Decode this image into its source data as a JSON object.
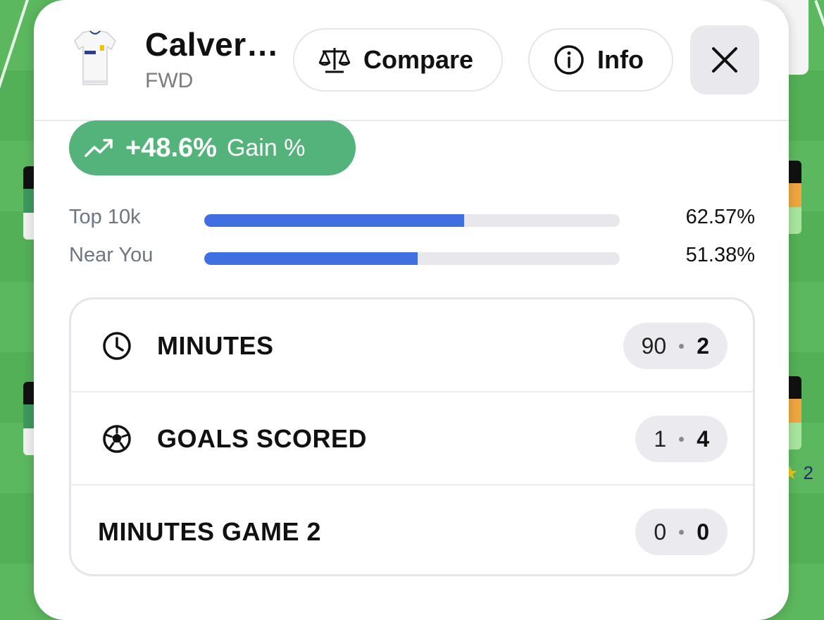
{
  "player": {
    "name": "Calver…",
    "position": "FWD",
    "jersey_icon": "leeds-jersey-icon"
  },
  "buttons": {
    "compare": "Compare",
    "info": "Info",
    "close_icon": "close-icon"
  },
  "gain": {
    "value": "+48.6%",
    "label": "Gain %",
    "color": "#53b37b",
    "icon": "trending-up-icon"
  },
  "ownership": [
    {
      "label": "Top 10k",
      "percent": 62.57,
      "display": "62.57%"
    },
    {
      "label": "Near You",
      "percent": 51.38,
      "display": "51.38%"
    }
  ],
  "stats": [
    {
      "icon": "clock-icon",
      "label": "MINUTES",
      "value": "90",
      "points": "2"
    },
    {
      "icon": "football-icon",
      "label": "GOALS SCORED",
      "value": "1",
      "points": "4"
    },
    {
      "icon": "",
      "label": "MINUTES GAME 2",
      "value": "0",
      "points": "0"
    }
  ],
  "background": {
    "star_count": "2",
    "bar_color": "#3f6fe0"
  }
}
